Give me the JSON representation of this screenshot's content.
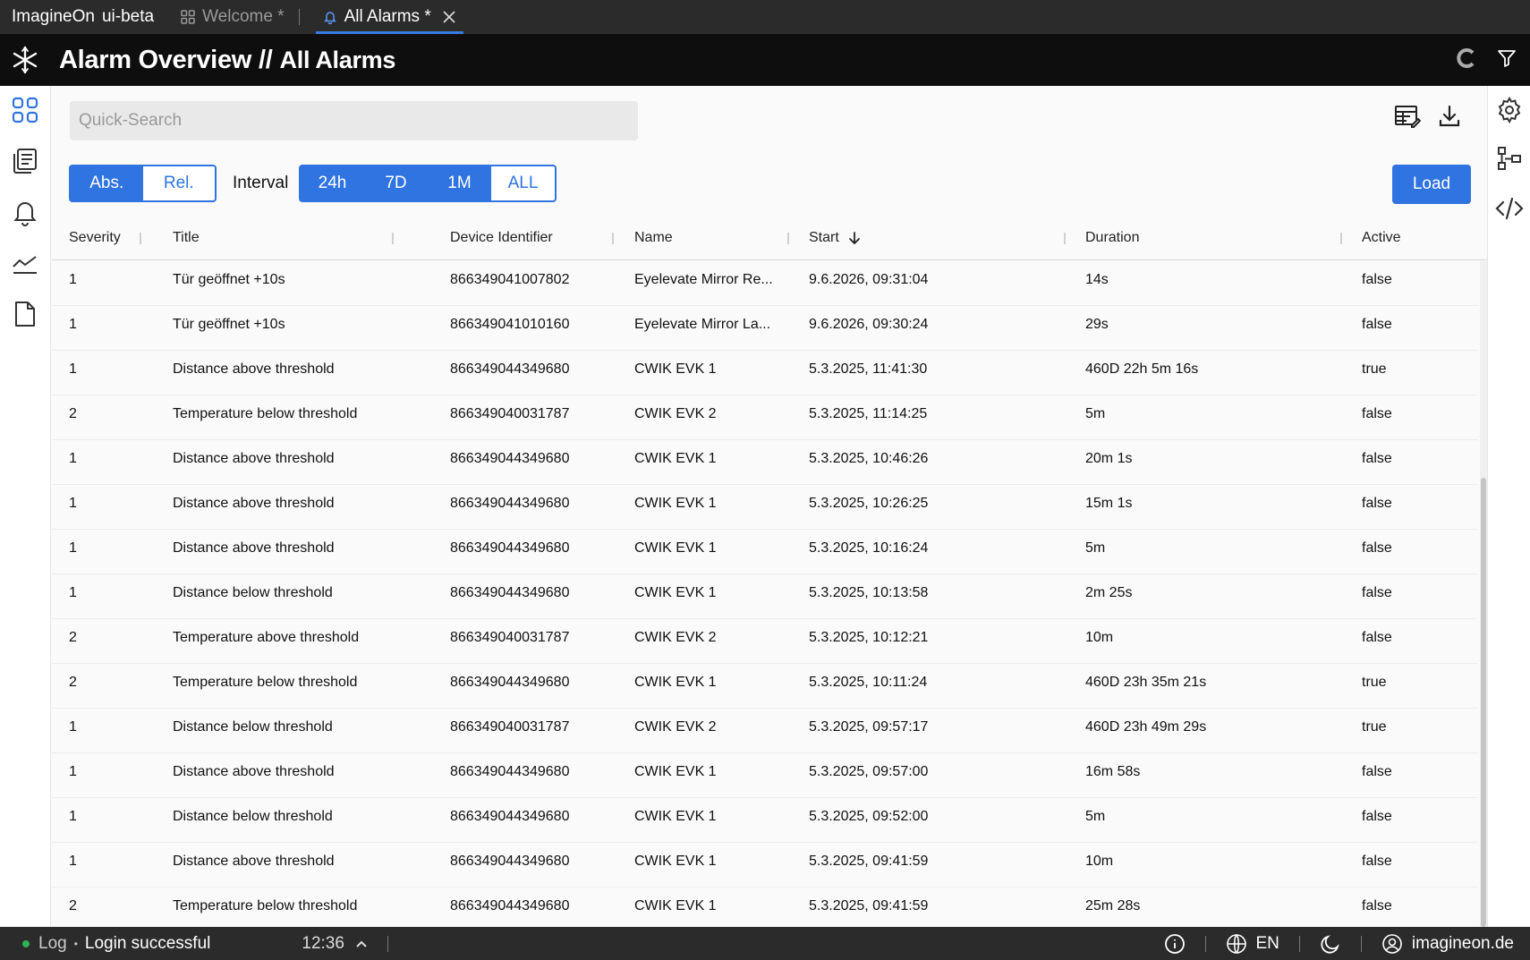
{
  "tabbar": {
    "app_name": "ImagineOn",
    "app_env": "ui-beta",
    "tabs": [
      {
        "label": "Welcome *",
        "icon": "grid-icon",
        "active": false
      },
      {
        "label": "All Alarms *",
        "icon": "bell-icon",
        "active": true
      }
    ]
  },
  "header": {
    "title": "Alarm Overview",
    "separator": "//",
    "subtitle": "All Alarms"
  },
  "toolbar": {
    "search_placeholder": "Quick-Search",
    "mode_abs": "Abs.",
    "mode_rel": "Rel.",
    "interval_label": "Interval",
    "intervals": [
      "24h",
      "7D",
      "1M",
      "ALL"
    ],
    "selected_interval": "ALL",
    "selected_mode": "Rel.",
    "load_label": "Load"
  },
  "table": {
    "columns": [
      "Severity",
      "Title",
      "Device Identifier",
      "Name",
      "Start",
      "Duration",
      "Active"
    ],
    "sort_column": "Start",
    "sort_direction": "descending",
    "rows": [
      {
        "severity": "1",
        "title": "Tür geöffnet +10s",
        "device": "866349041007802",
        "name": "Eyelevate Mirror Re...",
        "start": "9.6.2026, 09:31:04",
        "duration": "14s",
        "active": "false"
      },
      {
        "severity": "1",
        "title": "Tür geöffnet +10s",
        "device": "866349041010160",
        "name": "Eyelevate Mirror La...",
        "start": "9.6.2026, 09:30:24",
        "duration": "29s",
        "active": "false"
      },
      {
        "severity": "1",
        "title": "Distance above threshold",
        "device": "866349044349680",
        "name": "CWIK EVK 1",
        "start": "5.3.2025, 11:41:30",
        "duration": "460D 22h 5m 16s",
        "active": "true"
      },
      {
        "severity": "2",
        "title": "Temperature below threshold",
        "device": "866349040031787",
        "name": "CWIK EVK 2",
        "start": "5.3.2025, 11:14:25",
        "duration": "5m",
        "active": "false"
      },
      {
        "severity": "1",
        "title": "Distance above threshold",
        "device": "866349044349680",
        "name": "CWIK EVK 1",
        "start": "5.3.2025, 10:46:26",
        "duration": "20m 1s",
        "active": "false"
      },
      {
        "severity": "1",
        "title": "Distance above threshold",
        "device": "866349044349680",
        "name": "CWIK EVK 1",
        "start": "5.3.2025, 10:26:25",
        "duration": "15m 1s",
        "active": "false"
      },
      {
        "severity": "1",
        "title": "Distance above threshold",
        "device": "866349044349680",
        "name": "CWIK EVK 1",
        "start": "5.3.2025, 10:16:24",
        "duration": "5m",
        "active": "false"
      },
      {
        "severity": "1",
        "title": "Distance below threshold",
        "device": "866349044349680",
        "name": "CWIK EVK 1",
        "start": "5.3.2025, 10:13:58",
        "duration": "2m 25s",
        "active": "false"
      },
      {
        "severity": "2",
        "title": "Temperature above threshold",
        "device": "866349040031787",
        "name": "CWIK EVK 2",
        "start": "5.3.2025, 10:12:21",
        "duration": "10m",
        "active": "false"
      },
      {
        "severity": "2",
        "title": "Temperature below threshold",
        "device": "866349044349680",
        "name": "CWIK EVK 1",
        "start": "5.3.2025, 10:11:24",
        "duration": "460D 23h 35m 21s",
        "active": "true"
      },
      {
        "severity": "1",
        "title": "Distance below threshold",
        "device": "866349040031787",
        "name": "CWIK EVK 2",
        "start": "5.3.2025, 09:57:17",
        "duration": "460D 23h 49m 29s",
        "active": "true"
      },
      {
        "severity": "1",
        "title": "Distance above threshold",
        "device": "866349044349680",
        "name": "CWIK EVK 1",
        "start": "5.3.2025, 09:57:00",
        "duration": "16m 58s",
        "active": "false"
      },
      {
        "severity": "1",
        "title": "Distance below threshold",
        "device": "866349044349680",
        "name": "CWIK EVK 1",
        "start": "5.3.2025, 09:52:00",
        "duration": "5m",
        "active": "false"
      },
      {
        "severity": "1",
        "title": "Distance above threshold",
        "device": "866349044349680",
        "name": "CWIK EVK 1",
        "start": "5.3.2025, 09:41:59",
        "duration": "10m",
        "active": "false"
      },
      {
        "severity": "2",
        "title": "Temperature below threshold",
        "device": "866349044349680",
        "name": "CWIK EVK 1",
        "start": "5.3.2025, 09:41:59",
        "duration": "25m 28s",
        "active": "false"
      }
    ]
  },
  "left_nav": [
    "dashboard-icon",
    "documents-icon",
    "bell-icon",
    "chart-icon",
    "file-icon"
  ],
  "right_nav": [
    "gear-icon",
    "hierarchy-icon",
    "code-icon"
  ],
  "footer": {
    "log_label": "Log",
    "bullet": "•",
    "message": "Login successful",
    "time": "12:36",
    "language": "EN",
    "user": "imagineon.de"
  },
  "colors": {
    "accent": "#2f74e0",
    "status_ok": "#2fb255",
    "header_bg": "#0e0e0e",
    "bar_bg": "#2b2b2b"
  }
}
